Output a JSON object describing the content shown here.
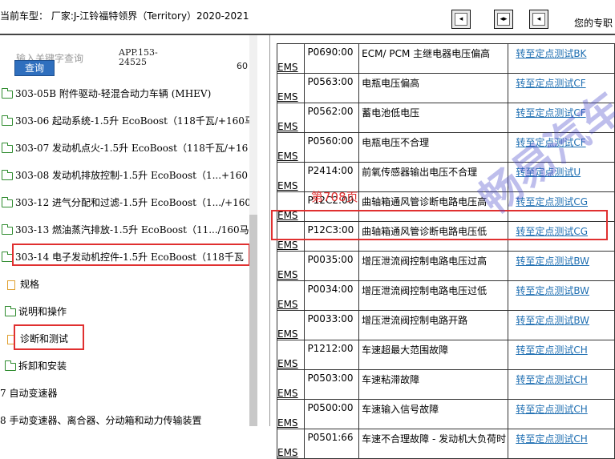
{
  "header": {
    "title": "当前车型：  厂家:J-江铃福特领界（Territory）2020-2021",
    "right_label": "您的专职",
    "buttons": [
      {
        "name": "prev-page-button",
        "glyph": "◂"
      },
      {
        "name": "fit-page-button",
        "glyph": "◂▸"
      },
      {
        "name": "next-page-button",
        "glyph": "◂"
      }
    ]
  },
  "search": {
    "placeholder": "输入关键字查询",
    "button": "查询",
    "app_code_line1": "APP.153-",
    "app_code_line2": "24525",
    "side_number": "60"
  },
  "tree": {
    "items": [
      {
        "label": "303-05B 附件驱动-轻混合动力车辆 (MHEV)"
      },
      {
        "label": "303-06 起动系统-1.5升 EcoBoost（118千瓦/+160马"
      },
      {
        "label": "303-07 发动机点火-1.5升 EcoBoost（118千瓦/+16"
      },
      {
        "label": "303-08 发动机排放控制-1.5升 EcoBoost（1...+160"
      },
      {
        "label": "303-12 进气分配和过滤-1.5升 EcoBoost（1.../+160"
      },
      {
        "label": "303-13 燃油蒸汽排放-1.5升 EcoBoost（11.../160马"
      },
      {
        "label": "303-14 电子发动机控件-1.5升 EcoBoost（118千瓦"
      }
    ],
    "sub_items": [
      {
        "label": "规格",
        "icon": "document-icon"
      },
      {
        "label": "说明和操作",
        "icon": "folder-icon"
      },
      {
        "label": "诊断和测试",
        "icon": "document-icon"
      },
      {
        "label": "拆卸和安装",
        "icon": "folder-icon"
      }
    ],
    "bottom_items": [
      {
        "label": "7 自动变速器"
      },
      {
        "label": "8 手动变速器、离合器、分动箱和动力传输装置"
      }
    ]
  },
  "page_label": "第708页",
  "watermark": "畅易汽车",
  "dtc_table": {
    "rows": [
      {
        "system": "EMS",
        "code": "P0690:00",
        "description": "ECM/ PCM 主继电器电压偏高",
        "link": "转至定点测试BK"
      },
      {
        "system": "EMS",
        "code": "P0563:00",
        "description": "电瓶电压偏高",
        "link": "转至定点测试CF"
      },
      {
        "system": "EMS",
        "code": "P0562:00",
        "description": "蓄电池低电压",
        "link": "转至定点测试CF"
      },
      {
        "system": "EMS",
        "code": "P0560:00",
        "description": "电瓶电压不合理",
        "link": "转至定点测试CF"
      },
      {
        "system": "EMS",
        "code": "P2414:00",
        "description": "前氧传感器输出电压不合理",
        "link": "转至定点测试U"
      },
      {
        "system": "EMS",
        "code": "P12C2:00",
        "description": "曲轴箱通风管诊断电路电压高",
        "link": "转至定点测试CG"
      },
      {
        "system": "EMS",
        "code": "P12C3:00",
        "description": "曲轴箱通风管诊断电路电压低",
        "link": "转至定点测试CG"
      },
      {
        "system": "EMS",
        "code": "P0035:00",
        "description": "增压泄流阀控制电路电压过高",
        "link": "转至定点测试BW"
      },
      {
        "system": "EMS",
        "code": "P0034:00",
        "description": "增压泄流阀控制电路电压过低",
        "link": "转至定点测试BW"
      },
      {
        "system": "EMS",
        "code": "P0033:00",
        "description": "增压泄流阀控制电路开路",
        "link": "转至定点测试BW"
      },
      {
        "system": "EMS",
        "code": "P1212:00",
        "description": "车速超最大范围故障",
        "link": "转至定点测试CH"
      },
      {
        "system": "EMS",
        "code": "P0503:00",
        "description": "车速粘滞故障",
        "link": "转至定点测试CH"
      },
      {
        "system": "EMS",
        "code": "P0500:00",
        "description": "车速输入信号故障",
        "link": "转至定点测试CH"
      },
      {
        "system": "EMS",
        "code": "P0501:66",
        "description": "车速不合理故障 - 发动机大负荷时",
        "link": "转至定点测试CH"
      }
    ]
  }
}
